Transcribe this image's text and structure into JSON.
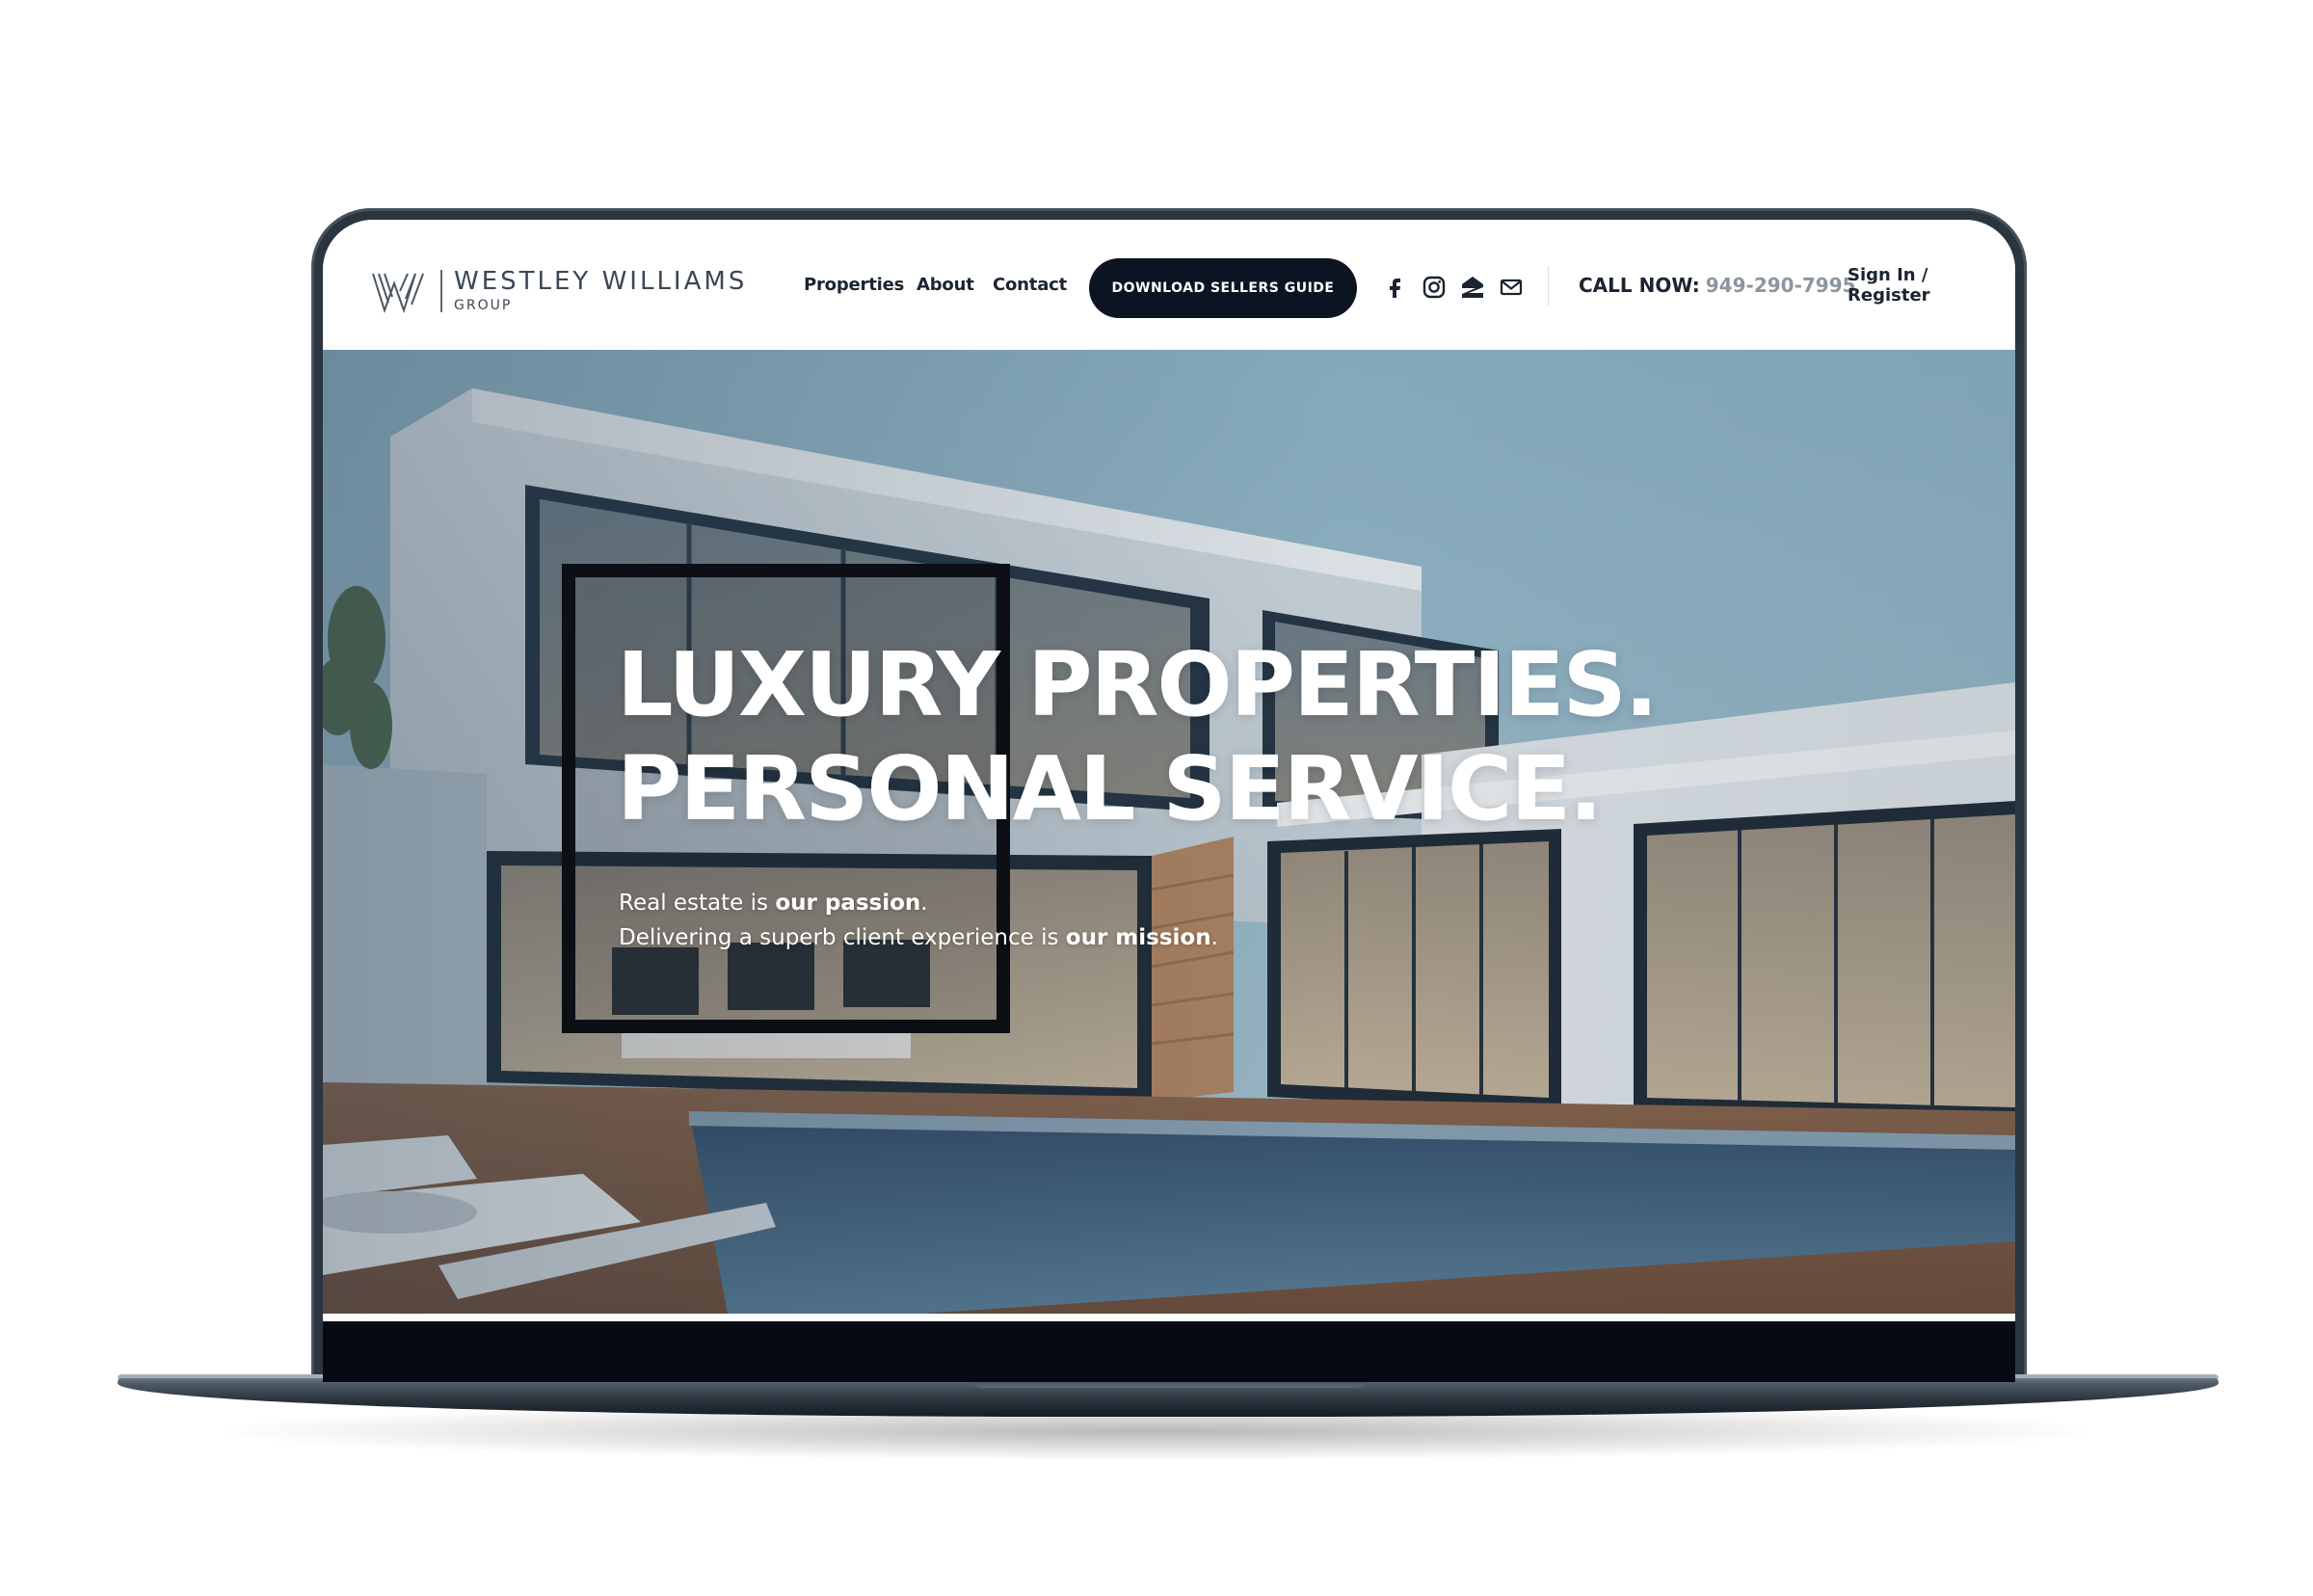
{
  "brand": {
    "name": "WESTLEY WILLIAMS",
    "subtitle": "GROUP"
  },
  "nav": {
    "items": [
      "Properties",
      "About",
      "Contact"
    ]
  },
  "cta": {
    "label": "DOWNLOAD SELLERS GUIDE"
  },
  "social_icons": [
    "facebook-icon",
    "instagram-icon",
    "zillow-icon",
    "email-icon"
  ],
  "call": {
    "label": "CALL NOW:",
    "number": "949-290-7995"
  },
  "auth": {
    "label": "Sign In / Register"
  },
  "hero": {
    "title_line1": "LUXURY PROPERTIES.",
    "title_line2": "PERSONAL SERVICE.",
    "sub1_pre": "Real estate is ",
    "sub1_bold": "our passion",
    "sub1_post": ".",
    "sub2_pre": "Delivering a superb client experience is ",
    "sub2_bold": "our mission",
    "sub2_post": "."
  },
  "colors": {
    "dark": "#0d1421",
    "text": "#1b2430",
    "muted": "#8d959e",
    "laptop": "#2b3540"
  }
}
